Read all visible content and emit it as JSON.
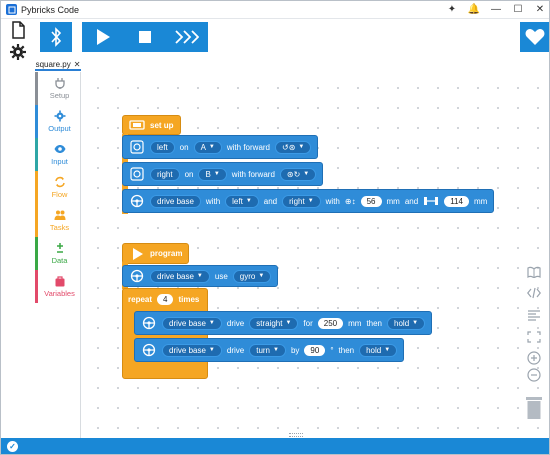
{
  "window": {
    "title": "Pybricks Code",
    "controls": [
      "✦",
      "🔔",
      "—",
      "☐",
      "✕"
    ]
  },
  "tab": {
    "label": "square.py",
    "close": "✕"
  },
  "categories": [
    {
      "label": "Setup",
      "color": "#8a8f96",
      "icon": "plug-icon"
    },
    {
      "label": "Output",
      "color": "#2f8cd8",
      "icon": "gear-icon"
    },
    {
      "label": "Input",
      "color": "#2fa6a6",
      "icon": "eye-icon"
    },
    {
      "label": "Flow",
      "color": "#f5a623",
      "icon": "loop-icon"
    },
    {
      "label": "Tasks",
      "color": "#f5a623",
      "icon": "people-icon"
    },
    {
      "label": "Data",
      "color": "#3aa845",
      "icon": "plus-minus-icon"
    },
    {
      "label": "Variables",
      "color": "#e24a6a",
      "icon": "bag-icon"
    }
  ],
  "blocks": {
    "setup": {
      "label": "set up"
    },
    "motor_left": {
      "name": "left",
      "on": "on",
      "port": "A",
      "with_forward": "with forward"
    },
    "motor_right": {
      "name": "right",
      "on": "on",
      "port": "B",
      "with_forward": "with forward"
    },
    "drive_base_setup": {
      "name": "drive base",
      "with": "with",
      "left": "left",
      "and1": "and",
      "right": "right",
      "with2": "with",
      "wheel": "56",
      "mm1": "mm",
      "and2": "and",
      "axle": "114",
      "mm2": "mm"
    },
    "program": {
      "label": "program"
    },
    "use_gyro": {
      "name": "drive base",
      "use": "use",
      "gyro": "gyro"
    },
    "repeat": {
      "label": "repeat",
      "count": "4",
      "times": "times"
    },
    "straight": {
      "name": "drive base",
      "drive": "drive",
      "mode": "straight",
      "for": "for",
      "value": "250",
      "unit": "mm",
      "then": "then",
      "after": "hold"
    },
    "turn": {
      "name": "drive base",
      "drive": "drive",
      "mode": "turn",
      "by": "by",
      "value": "90",
      "unit": "°",
      "then": "then",
      "after": "hold"
    }
  }
}
